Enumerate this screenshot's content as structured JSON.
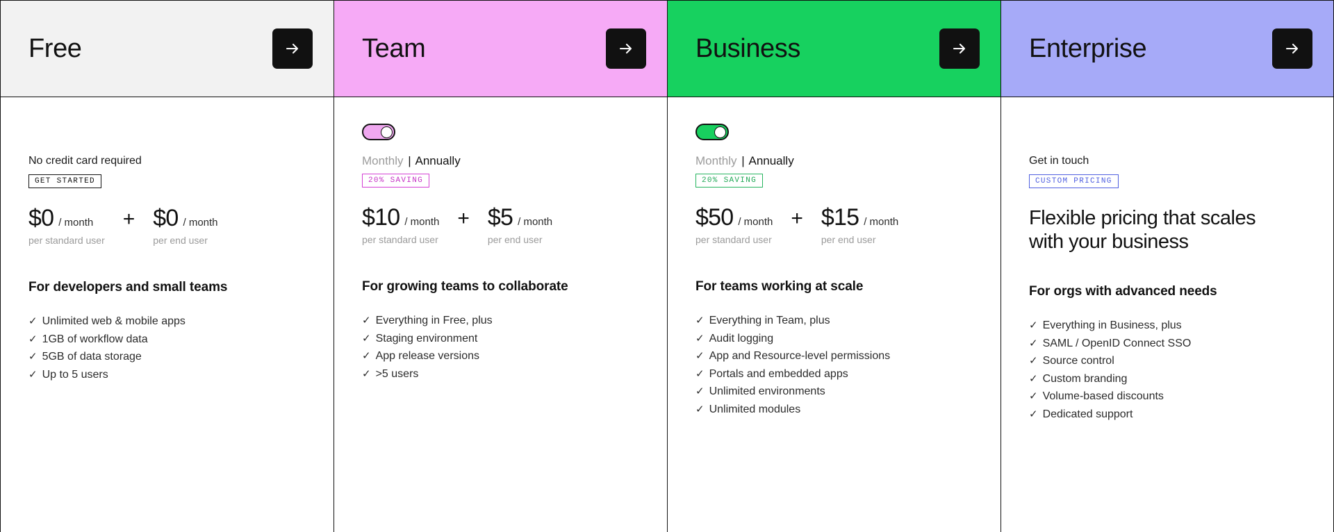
{
  "plans": [
    {
      "name": "Free",
      "header_bg": "#f2f2f2",
      "accent": "#111111",
      "cta_icon": "arrow-right-icon",
      "has_toggle": false,
      "note": "No credit card required",
      "tag": "GET STARTED",
      "tag_style": "dark",
      "prices": [
        {
          "amount": "$0",
          "period": "/ month",
          "sub": "per standard user"
        },
        {
          "amount": "$0",
          "period": "/ month",
          "sub": "per end user"
        }
      ],
      "plus": "+",
      "tagline": "For developers and small teams",
      "features": [
        "Unlimited web & mobile apps",
        "1GB of workflow data",
        "5GB of data storage",
        "Up to 5 users"
      ]
    },
    {
      "name": "Team",
      "header_bg": "#f6aaf6",
      "accent": "#c531c5",
      "cta_icon": "arrow-right-icon",
      "has_toggle": true,
      "toggle_color": "pink",
      "billing_monthly": "Monthly",
      "billing_separator": "|",
      "billing_annually": "Annually",
      "tag": "20% SAVING",
      "tag_style": "pink",
      "prices": [
        {
          "amount": "$10",
          "period": "/ month",
          "sub": "per standard user"
        },
        {
          "amount": "$5",
          "period": "/ month",
          "sub": "per end user"
        }
      ],
      "plus": "+",
      "tagline": "For growing teams to collaborate",
      "features": [
        "Everything in Free, plus",
        "Staging environment",
        "App release versions",
        ">5 users"
      ]
    },
    {
      "name": "Business",
      "header_bg": "#17d15f",
      "accent": "#1fa855",
      "cta_icon": "arrow-right-icon",
      "has_toggle": true,
      "toggle_color": "green",
      "billing_monthly": "Monthly",
      "billing_separator": "|",
      "billing_annually": "Annually",
      "tag": "20% SAVING",
      "tag_style": "green",
      "prices": [
        {
          "amount": "$50",
          "period": "/ month",
          "sub": "per standard user"
        },
        {
          "amount": "$15",
          "period": "/ month",
          "sub": "per end user"
        }
      ],
      "plus": "+",
      "tagline": "For teams working at scale",
      "features": [
        "Everything in Team, plus",
        "Audit logging",
        "App and Resource-level permissions",
        "Portals and embedded apps",
        "Unlimited environments",
        "Unlimited modules"
      ]
    },
    {
      "name": "Enterprise",
      "header_bg": "#a6aaf8",
      "accent": "#4f5fe0",
      "cta_icon": "arrow-right-icon",
      "has_toggle": false,
      "note": "Get in touch",
      "tag": "CUSTOM PRICING",
      "tag_style": "blue",
      "headline": "Flexible pricing that scales with your business",
      "tagline": "For orgs with advanced needs",
      "features": [
        "Everything in Business, plus",
        "SAML / OpenID Connect SSO",
        "Source control",
        "Custom branding",
        "Volume-based discounts",
        "Dedicated support"
      ]
    }
  ],
  "icons": {
    "check": "✓"
  }
}
